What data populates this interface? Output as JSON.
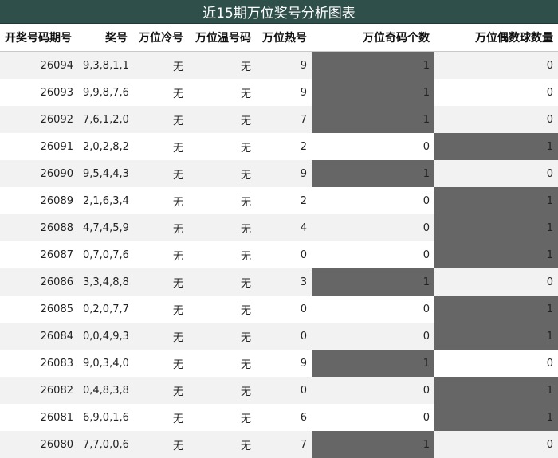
{
  "title": "近15期万位奖号分析图表",
  "columns": [
    "开奖号码期号",
    "奖号",
    "万位冷号",
    "万位温号码",
    "万位热号",
    "万位奇码个数",
    "万位偶数球数量"
  ],
  "highlight_color": "#666666",
  "rows": [
    {
      "issue": "26094",
      "numbers": "9,3,8,1,1",
      "cold": "无",
      "warm": "无",
      "hot": "9",
      "odd": "1",
      "even": "0"
    },
    {
      "issue": "26093",
      "numbers": "9,9,8,7,6",
      "cold": "无",
      "warm": "无",
      "hot": "9",
      "odd": "1",
      "even": "0"
    },
    {
      "issue": "26092",
      "numbers": "7,6,1,2,0",
      "cold": "无",
      "warm": "无",
      "hot": "7",
      "odd": "1",
      "even": "0"
    },
    {
      "issue": "26091",
      "numbers": "2,0,2,8,2",
      "cold": "无",
      "warm": "无",
      "hot": "2",
      "odd": "0",
      "even": "1"
    },
    {
      "issue": "26090",
      "numbers": "9,5,4,4,3",
      "cold": "无",
      "warm": "无",
      "hot": "9",
      "odd": "1",
      "even": "0"
    },
    {
      "issue": "26089",
      "numbers": "2,1,6,3,4",
      "cold": "无",
      "warm": "无",
      "hot": "2",
      "odd": "0",
      "even": "1"
    },
    {
      "issue": "26088",
      "numbers": "4,7,4,5,9",
      "cold": "无",
      "warm": "无",
      "hot": "4",
      "odd": "0",
      "even": "1"
    },
    {
      "issue": "26087",
      "numbers": "0,7,0,7,6",
      "cold": "无",
      "warm": "无",
      "hot": "0",
      "odd": "0",
      "even": "1"
    },
    {
      "issue": "26086",
      "numbers": "3,3,4,8,8",
      "cold": "无",
      "warm": "无",
      "hot": "3",
      "odd": "1",
      "even": "0"
    },
    {
      "issue": "26085",
      "numbers": "0,2,0,7,7",
      "cold": "无",
      "warm": "无",
      "hot": "0",
      "odd": "0",
      "even": "1"
    },
    {
      "issue": "26084",
      "numbers": "0,0,4,9,3",
      "cold": "无",
      "warm": "无",
      "hot": "0",
      "odd": "0",
      "even": "1"
    },
    {
      "issue": "26083",
      "numbers": "9,0,3,4,0",
      "cold": "无",
      "warm": "无",
      "hot": "9",
      "odd": "1",
      "even": "0"
    },
    {
      "issue": "26082",
      "numbers": "0,4,8,3,8",
      "cold": "无",
      "warm": "无",
      "hot": "0",
      "odd": "0",
      "even": "1"
    },
    {
      "issue": "26081",
      "numbers": "6,9,0,1,6",
      "cold": "无",
      "warm": "无",
      "hot": "6",
      "odd": "0",
      "even": "1"
    },
    {
      "issue": "26080",
      "numbers": "7,7,0,0,6",
      "cold": "无",
      "warm": "无",
      "hot": "7",
      "odd": "1",
      "even": "0"
    }
  ]
}
